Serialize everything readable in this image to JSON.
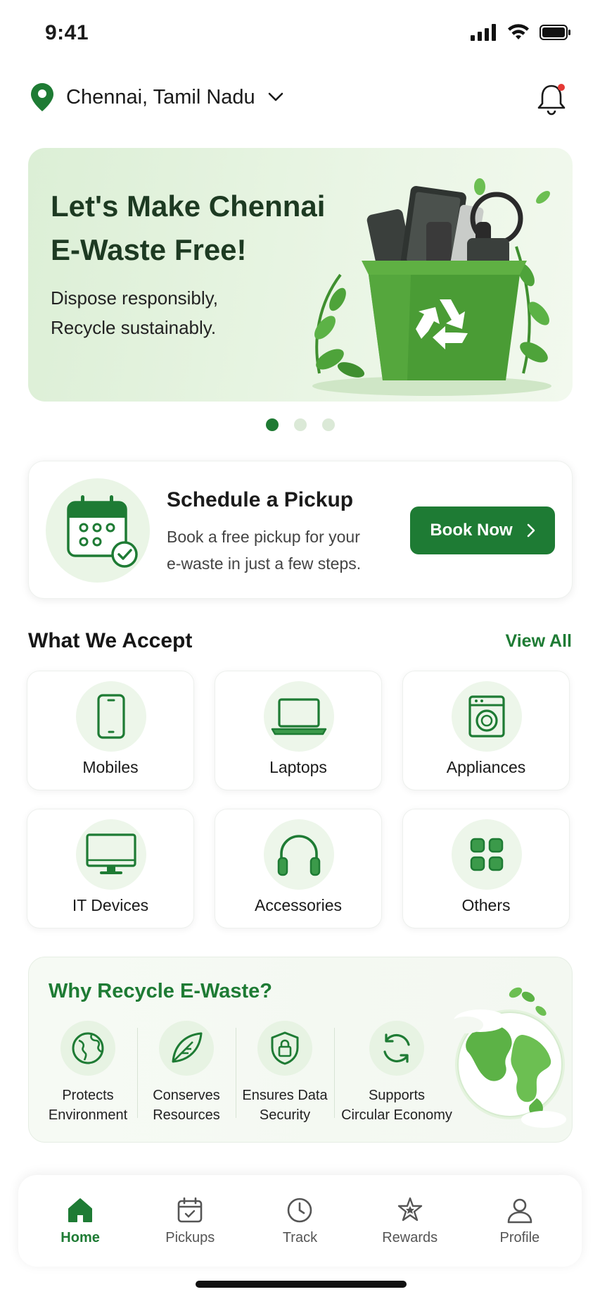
{
  "status": {
    "time": "9:41"
  },
  "location": {
    "label": "Chennai, Tamil Nadu"
  },
  "hero": {
    "title_line1": "Let's Make Chennai",
    "title_line2": "E-Waste Free!",
    "subtitle_line1": "Dispose responsibly,",
    "subtitle_line2": "Recycle sustainably."
  },
  "carousel": {
    "pages": 3,
    "active": 1
  },
  "pickup": {
    "title": "Schedule a Pickup",
    "desc_line1": "Book a free pickup for your",
    "desc_line2": "e-waste in just a few steps.",
    "button_label": "Book Now"
  },
  "accept": {
    "title": "What We Accept",
    "view_all": "View All",
    "categories": [
      {
        "label": "Mobiles",
        "icon": "mobile-icon"
      },
      {
        "label": "Laptops",
        "icon": "laptop-icon"
      },
      {
        "label": "Appliances",
        "icon": "washing-machine-icon"
      },
      {
        "label": "IT Devices",
        "icon": "monitor-icon"
      },
      {
        "label": "Accessories",
        "icon": "headphones-icon"
      },
      {
        "label": "Others",
        "icon": "grid-icon"
      }
    ]
  },
  "why": {
    "title": "Why Recycle E-Waste?",
    "items": [
      {
        "line1": "Protects",
        "line2": "Environment",
        "icon": "globe-icon"
      },
      {
        "line1": "Conserves",
        "line2": "Resources",
        "icon": "leaf-icon"
      },
      {
        "line1": "Ensures Data",
        "line2": "Security",
        "icon": "shield-lock-icon"
      },
      {
        "line1": "Supports",
        "line2": "Circular Economy",
        "icon": "recycle-arrows-icon"
      }
    ]
  },
  "tabs": [
    {
      "label": "Home",
      "icon": "home-icon",
      "active": true
    },
    {
      "label": "Pickups",
      "icon": "calendar-icon",
      "active": false
    },
    {
      "label": "Track",
      "icon": "clock-icon",
      "active": false
    },
    {
      "label": "Rewards",
      "icon": "star-badge-icon",
      "active": false
    },
    {
      "label": "Profile",
      "icon": "user-icon",
      "active": false
    }
  ],
  "colors": {
    "primary": "#1e7b34",
    "notification_dot": "#e53935",
    "hero_bg": "#e3f2dd"
  }
}
